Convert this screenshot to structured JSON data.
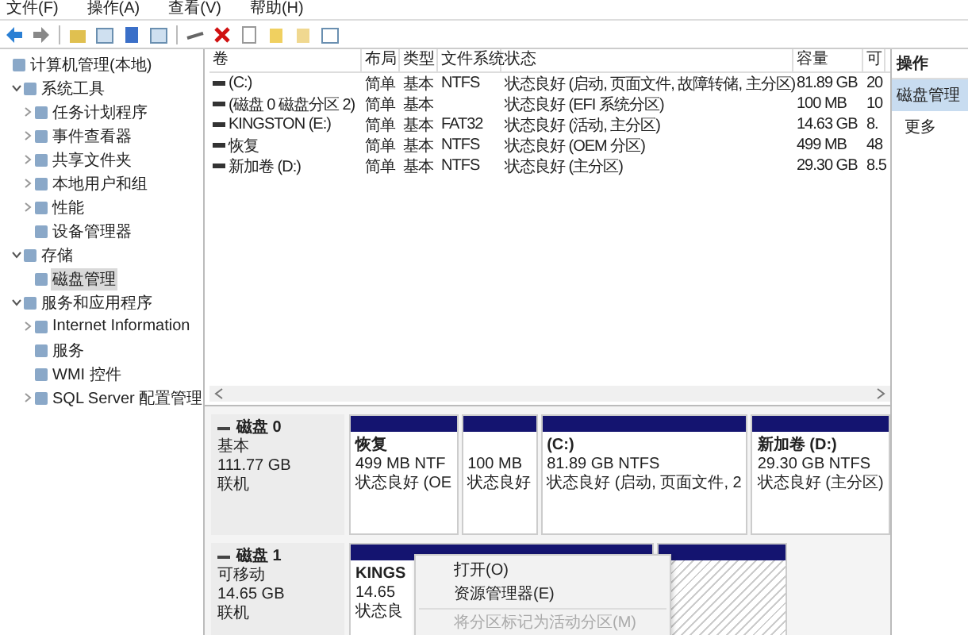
{
  "menu_bar": [
    "文件(F)",
    "操作(A)",
    "查看(V)",
    "帮助(H)"
  ],
  "tree": {
    "label": "计算机管理(本地)",
    "children": [
      {
        "label": "系统工具",
        "expanded": true,
        "children": [
          {
            "label": "任务计划程序",
            "expanded": false
          },
          {
            "label": "事件查看器",
            "expanded": false
          },
          {
            "label": "共享文件夹",
            "expanded": false
          },
          {
            "label": "本地用户和组",
            "expanded": false
          },
          {
            "label": "性能",
            "expanded": false
          },
          {
            "label": "设备管理器"
          }
        ]
      },
      {
        "label": "存储",
        "expanded": true,
        "children": [
          {
            "label": "磁盘管理",
            "selected": true
          }
        ]
      },
      {
        "label": "服务和应用程序",
        "expanded": true,
        "children": [
          {
            "label": "Internet Information",
            "expanded": false
          },
          {
            "label": "服务"
          },
          {
            "label": "WMI 控件"
          },
          {
            "label": "SQL Server 配置管理",
            "expanded": false
          }
        ]
      }
    ]
  },
  "table": {
    "columns": [
      "卷",
      "布局",
      "类型",
      "文件系统",
      "状态",
      "容量",
      "可"
    ],
    "rows": [
      [
        "(C:)",
        "简单",
        "基本",
        "NTFS",
        "状态良好 (启动, 页面文件, 故障转储, 主分区)",
        "81.89 GB",
        "20"
      ],
      [
        "(磁盘 0 磁盘分区 2)",
        "简单",
        "基本",
        null,
        "状态良好 (EFI 系统分区)",
        "100 MB",
        "10"
      ],
      [
        "KINGSTON (E:)",
        "简单",
        "基本",
        "FAT32",
        "状态良好 (活动, 主分区)",
        "14.63 GB",
        "8."
      ],
      [
        "恢复",
        "简单",
        "基本",
        "NTFS",
        "状态良好 (OEM 分区)",
        "499 MB",
        "48"
      ],
      [
        "新加卷 (D:)",
        "简单",
        "基本",
        "NTFS",
        "状态良好 (主分区)",
        "29.30 GB",
        "8.5"
      ]
    ]
  },
  "disks": [
    {
      "name": "磁盘 0",
      "type": "基本",
      "size": "111.77 GB",
      "status": "联机",
      "partitions": [
        {
          "kind": "primary",
          "name": "恢复",
          "size": "499 MB NTF",
          "status": "状态良好 (OE"
        },
        {
          "kind": "primary",
          "size": "100 MB",
          "status": "状态良好"
        },
        {
          "kind": "primary",
          "name": "(C:)",
          "size": "81.89 GB NTFS",
          "status": "状态良好 (启动, 页面文件, 2"
        },
        {
          "kind": "primary",
          "name": "新加卷  (D:)",
          "size": "29.30 GB NTFS",
          "status": "状态良好 (主分区)"
        }
      ]
    },
    {
      "name": "磁盘 1",
      "type": "可移动",
      "size": "14.65 GB",
      "status": "联机",
      "partitions": [
        {
          "kind": "primary",
          "name": "KINGS",
          "size": "14.65",
          "status": "状态良"
        },
        {
          "kind": "unallocated"
        }
      ]
    }
  ],
  "context_menu": [
    {
      "label": "打开(O)",
      "disabled": false
    },
    {
      "label": "资源管理器(E)",
      "disabled": false
    },
    {
      "label": "将分区标记为活动分区(M)",
      "disabled": true
    }
  ],
  "actions": {
    "title": "操作",
    "items": [
      {
        "label": "磁盘管理",
        "selected": true
      },
      {
        "label": "更多",
        "selected": false
      }
    ]
  }
}
